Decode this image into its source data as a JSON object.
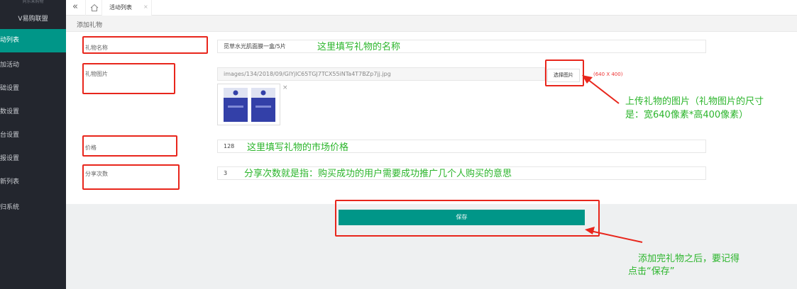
{
  "sidebar": {
    "brand": "同乐米购物",
    "subtitle": "V易购联盟",
    "items": [
      {
        "label": "动列表",
        "active": true
      },
      {
        "label": "加活动",
        "active": false
      },
      {
        "label": "础设置",
        "active": false
      },
      {
        "label": "数设置",
        "active": false
      },
      {
        "label": "台设置",
        "active": false
      },
      {
        "label": "报设置",
        "active": false
      },
      {
        "label": "新列表",
        "active": false
      },
      {
        "label": "归系统",
        "active": false
      }
    ]
  },
  "tabs": {
    "active_label": "活动列表",
    "close_glyph": "×"
  },
  "panel": {
    "title": "添加礼物"
  },
  "form": {
    "name_label": "礼物名称",
    "name_value": "觅草水光肌面膜一盒/5片",
    "image_label": "礼物图片",
    "image_path": "images/134/2018/09/GIYjlC65TGJ7TCX55iNTa4T7BZp7jj.jpg",
    "choose_button": "选择图片",
    "size_hint": "(640 X 400)",
    "remove_glyph": "×",
    "price_label": "价格",
    "price_value": "128",
    "share_label": "分享次数",
    "share_value": "3"
  },
  "save_button": "保存",
  "annotations": {
    "name_note": "这里填写礼物的名称",
    "image_note_line1": "上传礼物的图片（礼物图片的尺寸",
    "image_note_line2": "是：宽640像素*高400像素）",
    "price_note": "这里填写礼物的市场价格",
    "share_note": "分享次数就是指：购买成功的用户需要成功推广几个人购买的意思",
    "save_note_line1": "添加完礼物之后，要记得",
    "save_note_line2": "点击“保存”"
  },
  "colors": {
    "accent": "#009688",
    "sidebar_bg": "#23262e",
    "annotation_red": "#e8261c",
    "annotation_green": "#2bb52b"
  }
}
